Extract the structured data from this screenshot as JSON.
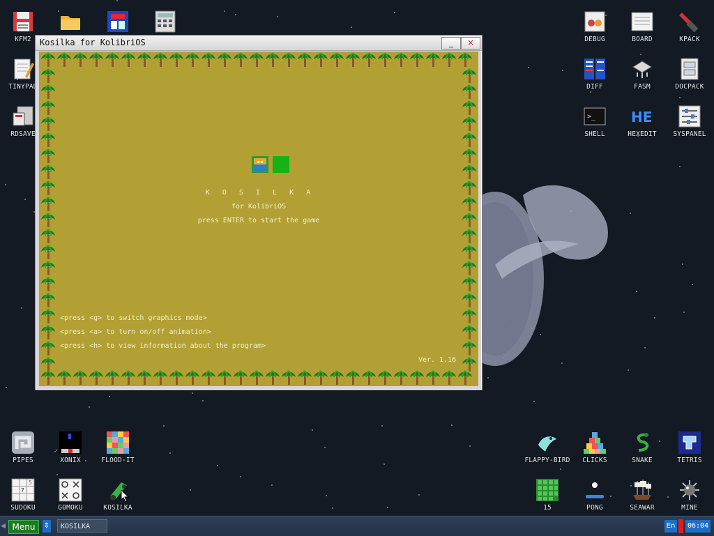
{
  "desktop": {
    "icons": [
      {
        "label": "KFM2",
        "icon": "floppy-icon"
      },
      {
        "label": "",
        "icon": "folder-icon"
      },
      {
        "label": "",
        "icon": "flyer-icon"
      },
      {
        "label": "",
        "icon": "calculator-icon"
      },
      {
        "label": "TINYPAD",
        "icon": "notepad-icon"
      },
      {
        "label": "RDSAVE",
        "icon": "rdsave-icon"
      },
      {
        "label": "DEBUG",
        "icon": "debug-icon"
      },
      {
        "label": "BOARD",
        "icon": "board-icon"
      },
      {
        "label": "KPACK",
        "icon": "kpack-icon"
      },
      {
        "label": "DIFF",
        "icon": "diff-icon"
      },
      {
        "label": "FASM",
        "icon": "fasm-icon"
      },
      {
        "label": "DOCPACK",
        "icon": "docpack-icon"
      },
      {
        "label": "SHELL",
        "icon": "shell-icon"
      },
      {
        "label": "HEXEDIT",
        "icon": "hexedit-icon"
      },
      {
        "label": "SYSPANEL",
        "icon": "syspanel-icon"
      },
      {
        "label": "PIPES",
        "icon": "pipes-icon"
      },
      {
        "label": "XONIX",
        "icon": "xonix-icon"
      },
      {
        "label": "FLOOD-IT",
        "icon": "flood-it-icon"
      },
      {
        "label": "SUDOKU",
        "icon": "sudoku-icon"
      },
      {
        "label": "GOMOKU",
        "icon": "gomoku-icon"
      },
      {
        "label": "KOSILKA",
        "icon": "kosilka-icon"
      },
      {
        "label": "FLAPPY-BIRD",
        "icon": "flappy-bird-icon"
      },
      {
        "label": "CLICKS",
        "icon": "clicks-icon"
      },
      {
        "label": "SNAKE",
        "icon": "snake-icon"
      },
      {
        "label": "TETRIS",
        "icon": "tetris-icon"
      },
      {
        "label": "15",
        "icon": "fifteen-icon"
      },
      {
        "label": "PONG",
        "icon": "pong-icon"
      },
      {
        "label": "SEAWAR",
        "icon": "seawar-icon"
      },
      {
        "label": "MINE",
        "icon": "mine-icon"
      }
    ]
  },
  "window": {
    "title": "Kosilka for KolibriOS",
    "minimize_label": "_",
    "close_label": "×",
    "game": {
      "title": "K  O  S  I  L  K  A",
      "subtitle": "for KolibriOS",
      "start_hint": "press ENTER to start the game",
      "hint_graphics": "<press <g> to switch graphics mode>",
      "hint_animation": "<press <a> to turn on/off animation>",
      "hint_info": "<press <h> to view information about the program>",
      "version": "Ver. 1.16"
    }
  },
  "taskbar": {
    "menu_label": "Menu",
    "task_label": "KOSILKA",
    "lang": "En",
    "clock": "06:04"
  },
  "colors": {
    "game_bg": "#b2a035",
    "desktop_bg": "#131a23",
    "taskbar_bg": "#223247"
  }
}
